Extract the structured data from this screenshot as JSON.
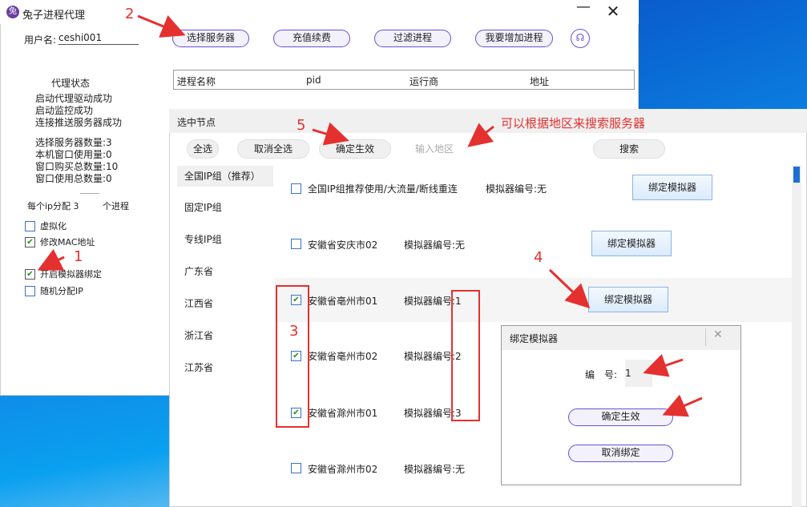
{
  "main_window": {
    "title": "兔子进程代理",
    "icon": "rabbit-app-icon",
    "minimize_glyph": "—",
    "close_glyph": "✕",
    "user_label": "用户名:",
    "user_value": "ceshi001",
    "toolbar": {
      "select_server": "选择服务器",
      "recharge": "充值续费",
      "filter_process": "过滤进程",
      "add_process": "我要增加进程",
      "support_icon": "headset-icon"
    },
    "table_headers": [
      "进程名称",
      "pid",
      "运行商",
      "地址"
    ],
    "status_title": "代理状态",
    "status_lines": [
      "启动代理驱动成功",
      "启动监控成功",
      "连接推送服务器成功"
    ],
    "stats": [
      "选择服务器数量:3",
      "本机窗口使用量:0",
      "窗口购买总数量:10",
      "窗口使用总数量:0"
    ],
    "ip_dist_label": "每个ip分配 3",
    "per_process_label": "个进程",
    "options": [
      {
        "label": "虚拟化",
        "checked": false
      },
      {
        "label": "修改MAC地址",
        "checked": true
      },
      {
        "label": "开启模拟器绑定",
        "checked": true
      },
      {
        "label": "随机分配IP",
        "checked": false
      }
    ]
  },
  "node_window": {
    "title": "选中节点",
    "buttons": {
      "select_all": "全选",
      "deselect_all": "取消全选",
      "confirm": "确定生效",
      "region_placeholder": "输入地区",
      "search": "搜索"
    },
    "regions": [
      "全国IP组（推荐）",
      "固定IP组",
      "专线IP组",
      "广东省",
      "江西省",
      "浙江省",
      "江苏省"
    ],
    "nodes": [
      {
        "name": "全国IP组推荐使用/大流量/断线重连",
        "emulator": "模拟器编号:无",
        "checked": false,
        "bind": "绑定模拟器"
      },
      {
        "name": "安徽省安庆市02",
        "emulator": "模拟器编号:无",
        "checked": false,
        "bind": "绑定模拟器"
      },
      {
        "name": "安徽省亳州市01",
        "emulator": "模拟器编号:1",
        "checked": true,
        "bind": "绑定模拟器"
      },
      {
        "name": "安徽省亳州市02",
        "emulator": "模拟器编号:2",
        "checked": true
      },
      {
        "name": "安徽省滁州市01",
        "emulator": "模拟器编号:3",
        "checked": true
      },
      {
        "name": "安徽省滁州市02",
        "emulator": "模拟器编号:无",
        "checked": false
      }
    ]
  },
  "bind_popup": {
    "title": "绑定模拟器",
    "close_glyph": "✕",
    "number_label": "编　号:",
    "number_value": "1",
    "confirm": "确定生效",
    "unbind": "取消绑定"
  },
  "annotations": {
    "step1": "1",
    "step2": "2",
    "step3": "3",
    "step4": "4",
    "step5": "5",
    "hint": "可以根据地区来搜索服务器",
    "color": "#e53030"
  }
}
